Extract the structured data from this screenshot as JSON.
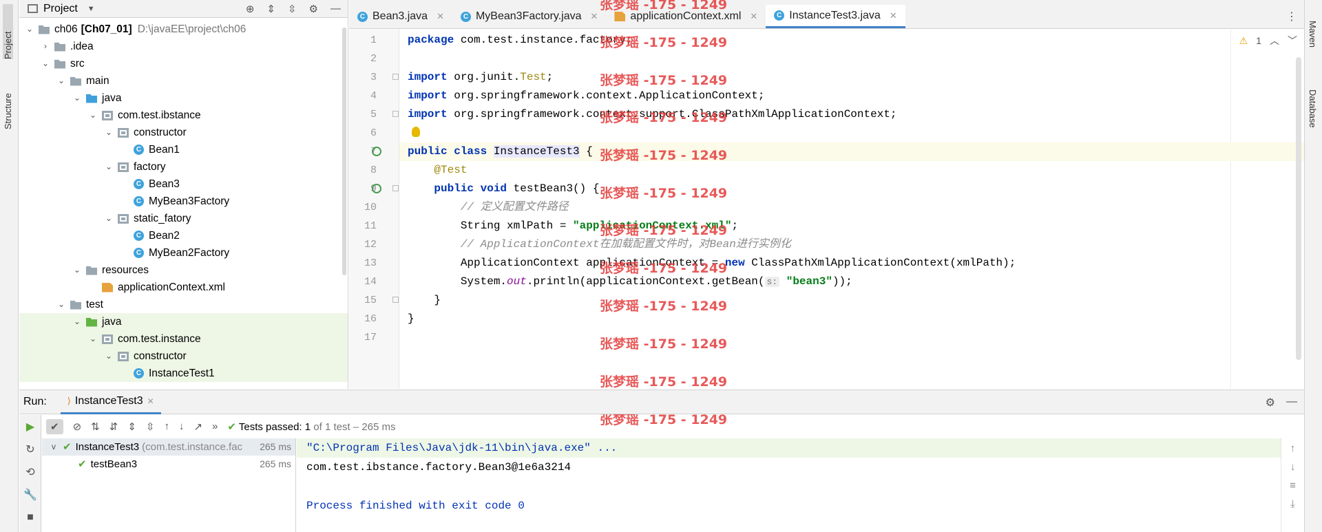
{
  "left_tabs": {
    "project": "Project",
    "structure": "Structure"
  },
  "right_tabs": {
    "maven": "Maven",
    "database": "Database"
  },
  "project_panel": {
    "title": "Project",
    "tree": [
      {
        "indent": 0,
        "chev": "v",
        "icon": "module",
        "label": "ch06",
        "bold_suffix": "[Ch07_01]",
        "muted": "D:\\javaEE\\project\\ch06"
      },
      {
        "indent": 1,
        "chev": ">",
        "icon": "folder",
        "label": ".idea"
      },
      {
        "indent": 1,
        "chev": "v",
        "icon": "folder",
        "label": "src"
      },
      {
        "indent": 2,
        "chev": "v",
        "icon": "folder",
        "label": "main"
      },
      {
        "indent": 3,
        "chev": "v",
        "icon": "folder-blue",
        "label": "java"
      },
      {
        "indent": 4,
        "chev": "v",
        "icon": "package",
        "label": "com.test.ibstance"
      },
      {
        "indent": 5,
        "chev": "v",
        "icon": "package",
        "label": "constructor"
      },
      {
        "indent": 6,
        "chev": "",
        "icon": "class",
        "label": "Bean1"
      },
      {
        "indent": 5,
        "chev": "v",
        "icon": "package",
        "label": "factory"
      },
      {
        "indent": 6,
        "chev": "",
        "icon": "class",
        "label": "Bean3"
      },
      {
        "indent": 6,
        "chev": "",
        "icon": "class",
        "label": "MyBean3Factory"
      },
      {
        "indent": 5,
        "chev": "v",
        "icon": "package",
        "label": "static_fatory"
      },
      {
        "indent": 6,
        "chev": "",
        "icon": "class",
        "label": "Bean2"
      },
      {
        "indent": 6,
        "chev": "",
        "icon": "class",
        "label": "MyBean2Factory"
      },
      {
        "indent": 3,
        "chev": "v",
        "icon": "folder",
        "label": "resources"
      },
      {
        "indent": 4,
        "chev": "",
        "icon": "xml",
        "label": "applicationContext.xml"
      },
      {
        "indent": 2,
        "chev": "v",
        "icon": "folder",
        "label": "test"
      },
      {
        "indent": 3,
        "chev": "v",
        "icon": "folder-green",
        "label": "java",
        "hl": true
      },
      {
        "indent": 4,
        "chev": "v",
        "icon": "package",
        "label": "com.test.instance",
        "hl": true
      },
      {
        "indent": 5,
        "chev": "v",
        "icon": "package",
        "label": "constructor",
        "hl": true
      },
      {
        "indent": 6,
        "chev": "",
        "icon": "class",
        "label": "InstanceTest1",
        "hl": true
      }
    ]
  },
  "editor_tabs": [
    {
      "label": "Bean3.java",
      "icon": "class",
      "active": false
    },
    {
      "label": "MyBean3Factory.java",
      "icon": "class",
      "active": false
    },
    {
      "label": "applicationContext.xml",
      "icon": "xml",
      "active": false
    },
    {
      "label": "InstanceTest3.java",
      "icon": "class",
      "active": true
    }
  ],
  "editor": {
    "warning_count": "1",
    "lines": {
      "l1": {
        "n": "1"
      },
      "l2": {
        "n": "2"
      },
      "l3": {
        "n": "3"
      },
      "l4": {
        "n": "4"
      },
      "l5": {
        "n": "5"
      },
      "l6": {
        "n": "6"
      },
      "l7": {
        "n": "7"
      },
      "l8": {
        "n": "8"
      },
      "l9": {
        "n": "9"
      },
      "l10": {
        "n": "10"
      },
      "l11": {
        "n": "11"
      },
      "l12": {
        "n": "12"
      },
      "l13": {
        "n": "13"
      },
      "l14": {
        "n": "14"
      },
      "l15": {
        "n": "15"
      },
      "l16": {
        "n": "16"
      },
      "l17": {
        "n": "17"
      }
    },
    "code": {
      "package_kw": "package",
      "package_name": " com.test.instance.factory;",
      "import_kw": "import",
      "import1": " org.junit.",
      "import1_cls": "Test",
      "semi": ";",
      "import2": " org.springframework.context.ApplicationContext;",
      "import3": " org.springframework.context.support.ClassPathXmlApplicationContext;",
      "public_class": "public class ",
      "class_name": "InstanceTest3",
      "brace_open": " {",
      "annotation": "@Test",
      "method_kw": "public void ",
      "method_name": "testBean3() {",
      "comment1": "// 定义配置文件路径",
      "xmlpath_decl": "String xmlPath = ",
      "xmlpath_val": "\"applicationContext.xml\"",
      "comment2": "// ApplicationContext在加载配置文件时，对Bean进行实例化",
      "ctx_decl": "ApplicationContext applicationContext = ",
      "new_kw": "new",
      "ctx_new": " ClassPathXmlApplicationContext(xmlPath);",
      "print_pre": "System.",
      "print_out": "out",
      "print_mid": ".println(applicationContext.getBean(",
      "print_hint": "s:",
      "print_arg": "\"bean3\"",
      "print_end": "));",
      "close_method": "}",
      "close_class": "}"
    }
  },
  "watermark": "张梦瑶 -175 - 1249",
  "run_panel": {
    "label": "Run:",
    "tab": "InstanceTest3",
    "status_bold": "Tests passed: 1",
    "status_rest": " of 1 test – 265 ms",
    "tests": [
      {
        "name": "InstanceTest3",
        "detail": "(com.test.instance.fac",
        "time": "265 ms"
      },
      {
        "name": "testBean3",
        "time": "265 ms"
      }
    ],
    "console": {
      "cmd": "\"C:\\Program Files\\Java\\jdk-11\\bin\\java.exe\" ...",
      "output": "com.test.ibstance.factory.Bean3@1e6a3214",
      "exit": "Process finished with exit code 0"
    }
  }
}
